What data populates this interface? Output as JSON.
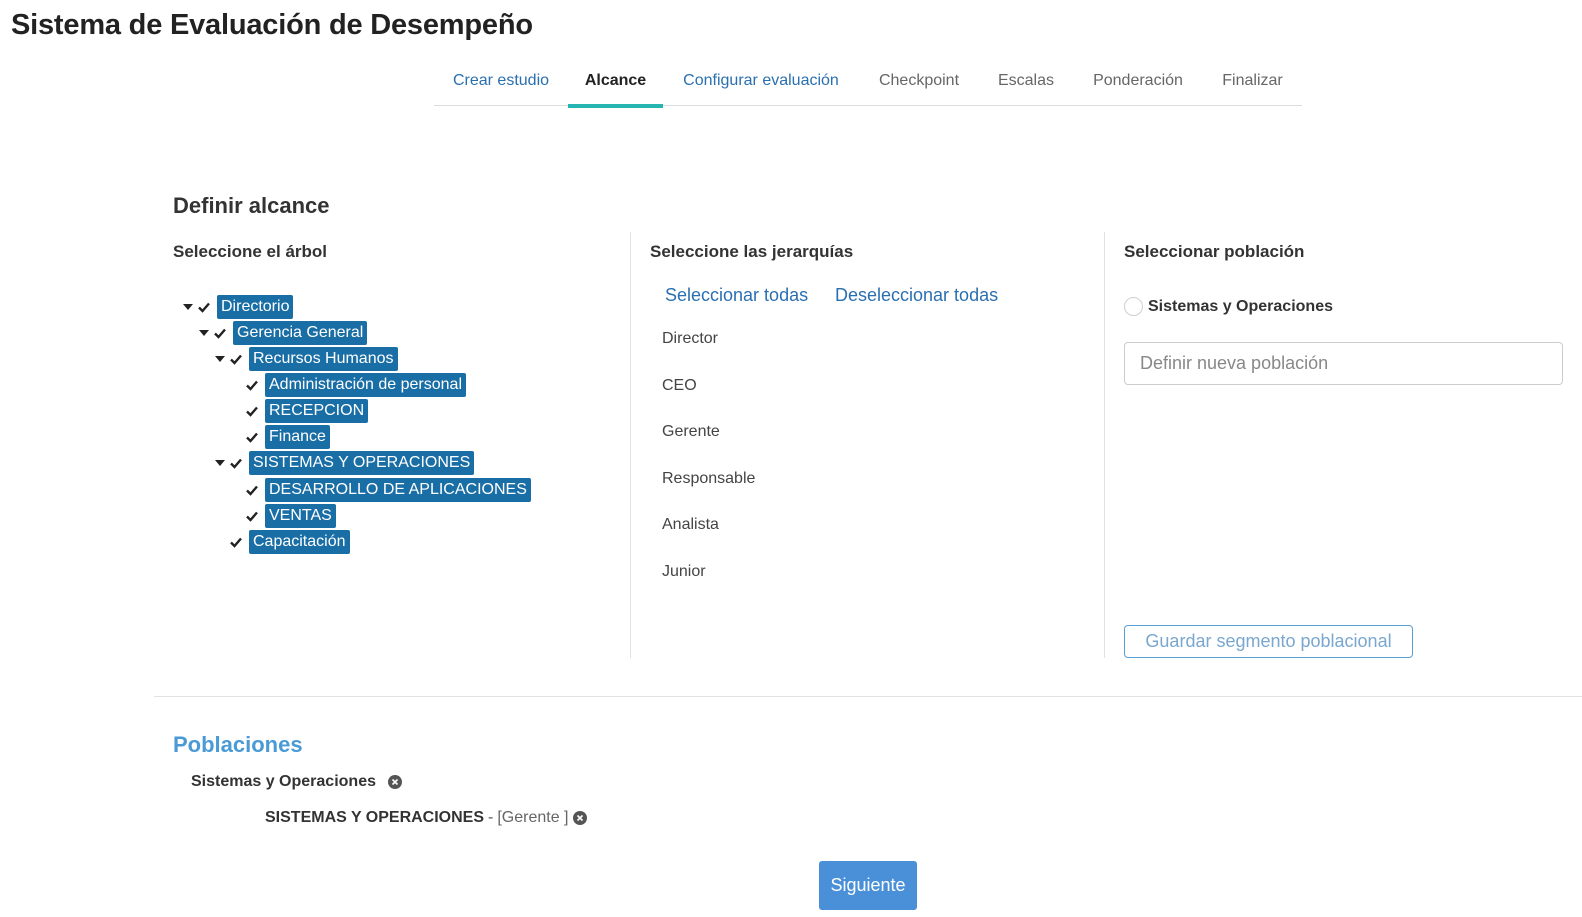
{
  "app": {
    "title": "Sistema de Evaluación de Desempeño"
  },
  "tabs": [
    {
      "label": "Crear estudio"
    },
    {
      "label": "Alcance"
    },
    {
      "label": "Configurar evaluación"
    },
    {
      "label": "Checkpoint"
    },
    {
      "label": "Escalas"
    },
    {
      "label": "Ponderación"
    },
    {
      "label": "Finalizar"
    }
  ],
  "scope": {
    "title": "Definir alcance",
    "tree": {
      "heading": "Seleccione el árbol",
      "nodes": [
        {
          "label": "Directorio",
          "checked": true,
          "expanded": true
        },
        {
          "label": "Gerencia General",
          "checked": true,
          "expanded": true
        },
        {
          "label": "Recursos Humanos",
          "checked": true,
          "expanded": true
        },
        {
          "label": "Administración de personal",
          "checked": true
        },
        {
          "label": "RECEPCION",
          "checked": true
        },
        {
          "label": "Finance",
          "checked": true
        },
        {
          "label": "SISTEMAS Y OPERACIONES",
          "checked": true,
          "expanded": true
        },
        {
          "label": "DESARROLLO DE APLICACIONES",
          "checked": true
        },
        {
          "label": "VENTAS",
          "checked": true
        },
        {
          "label": "Capacitación",
          "checked": true
        }
      ]
    },
    "hierarchies": {
      "heading": "Seleccione las jerarquías",
      "select_all": "Seleccionar todas",
      "deselect_all": "Deseleccionar todas",
      "items": [
        "Director",
        "CEO",
        "Gerente",
        "Responsable",
        "Analista",
        "Junior"
      ]
    },
    "population": {
      "heading": "Seleccionar población",
      "option": "Sistemas y Operaciones",
      "input_placeholder": "Definir nueva población",
      "save_label": "Guardar segmento poblacional"
    }
  },
  "populations": {
    "title": "Poblaciones",
    "items": [
      {
        "name": "Sistemas y Operaciones",
        "unit": "SISTEMAS Y OPERACIONES",
        "separator": "-",
        "role": "[Gerente ]"
      }
    ]
  },
  "actions": {
    "next_label": "Siguiente"
  },
  "colors": {
    "accent": "#26b5b0",
    "node_bg": "#1a6ea6",
    "link": "#2a6fb0",
    "primary_button": "#4a90d9",
    "section_title": "#4a9ad6"
  }
}
